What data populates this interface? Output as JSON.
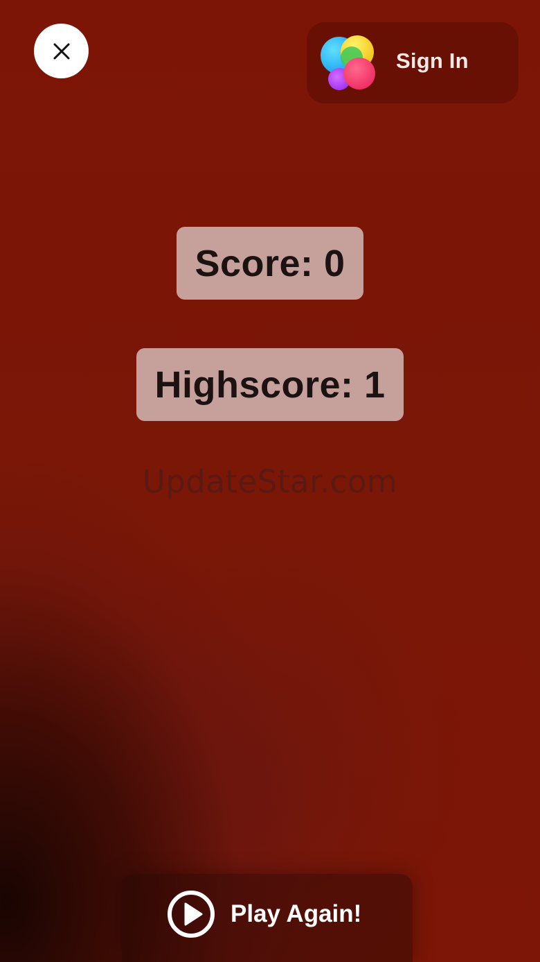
{
  "header": {
    "close_icon": "close-icon",
    "signin": {
      "label": "Sign In",
      "icon": "game-center-icon"
    }
  },
  "stats": {
    "score_text": "Score: 0",
    "highscore_text": "Highscore: 1"
  },
  "watermark": "UpdateStar.com",
  "footer": {
    "play_again_label": "Play Again!",
    "play_icon": "play-circle-icon"
  },
  "colors": {
    "background": "#7c1506",
    "score_box": "#c6a19c",
    "score_text": "#1c1212"
  }
}
